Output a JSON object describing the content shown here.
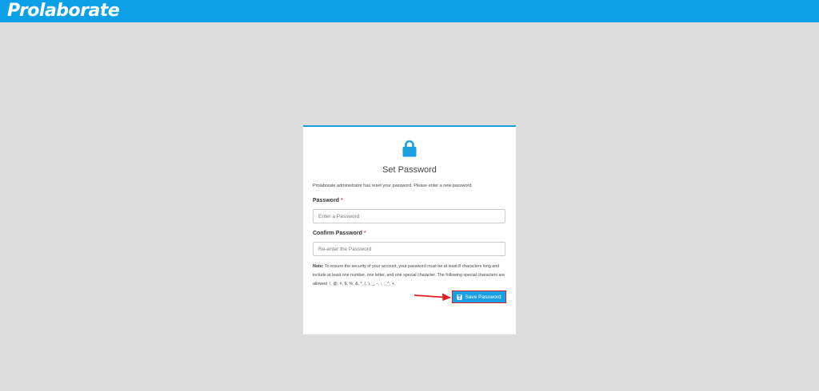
{
  "header": {
    "brand": "Prolaborate"
  },
  "card": {
    "icon": "lock-icon",
    "title": "Set Password",
    "intro": "Prolaborate administrator has reset your password. Please enter a new password.",
    "password": {
      "label": "Password",
      "required_mark": "*",
      "placeholder": "Enter a Password",
      "value": ""
    },
    "confirm": {
      "label": "Confirm Password",
      "required_mark": "*",
      "placeholder": "Re-enter the Password",
      "value": ""
    },
    "note": {
      "prefix": "Note:",
      "text": "To ensure the security of your account, your password must be at least 8 characters long and include at least one number, one letter, and one special character. The following special characters are allowed: !, @, #, $, %, &, *, (, ), _, -, :, ;, ^, +."
    },
    "save_button": {
      "label": "Save Password",
      "icon": "floppy-disk-icon"
    }
  },
  "colors": {
    "topbar": "#0da0e6",
    "background": "#dcdcdc",
    "accent": "#1aa0e0",
    "highlight": "#e02020",
    "required": "#d9534f"
  }
}
